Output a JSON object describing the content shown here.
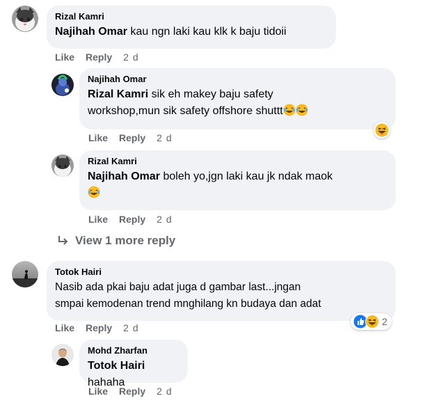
{
  "comments": [
    {
      "author": "Rizal Kamri",
      "tag": "Najihah Omar",
      "body": "kau ngn laki kau klk k baju tidoii",
      "actions": {
        "like": "Like",
        "reply": "Reply",
        "time": "2 d"
      }
    },
    {
      "author": "Najihah Omar",
      "tag": "Rizal Kamri",
      "body_line1": "sik eh makey baju safety",
      "body_line2": "workshop,mun sik safety offshore shuttt",
      "emoji": "laughing-emoji",
      "actions": {
        "like": "Like",
        "reply": "Reply",
        "time": "2 d"
      }
    },
    {
      "author": "Rizal Kamri",
      "tag": "Najihah Omar",
      "body": "boleh yo,jgn laki kau jk ndak maok",
      "emoji": "laughing-emoji",
      "actions": {
        "like": "Like",
        "reply": "Reply",
        "time": "2 d"
      }
    },
    {
      "author": "Totok Hairi",
      "body_line1": "Nasib ada pkai baju adat juga d gambar last...jngan",
      "body_line2": "smpai kemodenan trend mnghilang kn budaya dan adat",
      "reactions": {
        "icons": [
          "like-reaction-icon",
          "haha-reaction-icon"
        ],
        "count": "2"
      },
      "actions": {
        "like": "Like",
        "reply": "Reply",
        "time": "2 d"
      }
    },
    {
      "author": "Mohd Zharfan",
      "tag": "Totok Hairi",
      "body": "hahaha",
      "actions": {
        "like": "Like",
        "reply": "Reply",
        "time": "2 d"
      }
    }
  ],
  "view_more": {
    "label": "View 1 more reply",
    "icon": "reply-arrow-icon"
  },
  "colors": {
    "bubble": "#f0f2f5",
    "secondary_text": "#65676b",
    "like_blue": "#1877f2",
    "haha_yellow": "#f7b928"
  }
}
